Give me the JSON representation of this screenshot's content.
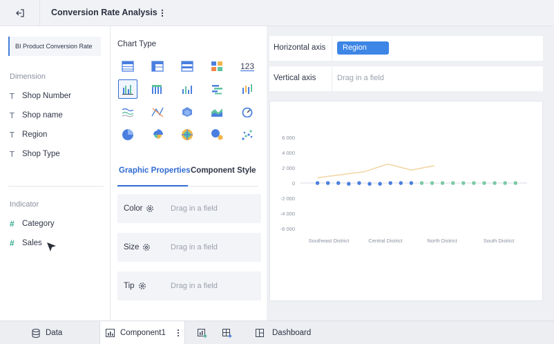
{
  "header": {
    "title": "Conversion Rate Analysis"
  },
  "dataset": {
    "name": "BI Product Conversion Rate"
  },
  "dimension": {
    "label": "Dimension",
    "fields": [
      {
        "name": "Shop Number"
      },
      {
        "name": "Shop name"
      },
      {
        "name": "Region"
      },
      {
        "name": "Shop Type"
      }
    ]
  },
  "indicator": {
    "label": "Indicator",
    "fields": [
      {
        "name": "Category"
      },
      {
        "name": "Sales"
      }
    ]
  },
  "chart_type": {
    "label": "Chart Type",
    "icons": [
      "table-icon",
      "cross-table-icon",
      "detail-table-icon",
      "color-block-icon",
      "kpi-number-icon",
      "grouped-bar-icon",
      "multi-series-bar-icon",
      "column-icon",
      "stacked-bar-icon",
      "range-bar-icon",
      "wave-line-icon",
      "scatter-line-icon",
      "polygon-icon",
      "area-icon",
      "gauge-icon",
      "pie-icon",
      "rose-pie-icon",
      "radar-icon",
      "bubble-icon",
      "dot-scatter-icon"
    ],
    "selected_index": 5
  },
  "tabs": {
    "graphic": "Graphic Properties",
    "component": "Component Style"
  },
  "properties": [
    {
      "name": "Color",
      "drop": "Drag in a field"
    },
    {
      "name": "Size",
      "drop": "Drag in a field"
    },
    {
      "name": "Tip",
      "drop": "Drag in a field"
    }
  ],
  "axes": {
    "horizontal_label": "Horizontal axis",
    "horizontal_value": "Region",
    "vertical_label": "Vertical axis",
    "vertical_drop": "Drag in a field"
  },
  "chart_data": {
    "type": "line",
    "categories": [
      "Southeast District",
      "Central District",
      "North District",
      "South District"
    ],
    "y_ticks": [
      "6 000",
      "4 000",
      "2 000",
      "0",
      "-2 000",
      "-4 000",
      "-6 000"
    ],
    "ylim": [
      -6000,
      6000
    ],
    "line": {
      "x": [
        0,
        0.45,
        0.9,
        1.35,
        1.8,
        2.25
      ],
      "y": [
        700,
        1100,
        1500,
        2500,
        1700,
        2300
      ],
      "color": "#f2d7a6"
    },
    "points": [
      {
        "x": 0.0,
        "y": 0
      },
      {
        "x": 0.2,
        "y": 0
      },
      {
        "x": 0.4,
        "y": 0
      },
      {
        "x": 0.6,
        "y": -100
      },
      {
        "x": 0.8,
        "y": 0
      },
      {
        "x": 1.0,
        "y": -100
      },
      {
        "x": 1.2,
        "y": -100
      },
      {
        "x": 1.4,
        "y": 0
      },
      {
        "x": 1.6,
        "y": 0
      },
      {
        "x": 1.8,
        "y": 0
      },
      {
        "x": 2.0,
        "y": 0
      },
      {
        "x": 2.2,
        "y": 0
      },
      {
        "x": 2.4,
        "y": 0
      },
      {
        "x": 2.6,
        "y": 0
      },
      {
        "x": 2.8,
        "y": 0
      },
      {
        "x": 3.0,
        "y": 0
      },
      {
        "x": 3.2,
        "y": 0
      },
      {
        "x": 3.4,
        "y": 0
      },
      {
        "x": 3.6,
        "y": 0
      },
      {
        "x": 3.8,
        "y": 0
      }
    ],
    "colors": {
      "blue": "#4a7fdf",
      "green": "#7cc9a6"
    }
  },
  "bottom": {
    "data": "Data",
    "component": "Component1",
    "dashboard": "Dashboard"
  }
}
